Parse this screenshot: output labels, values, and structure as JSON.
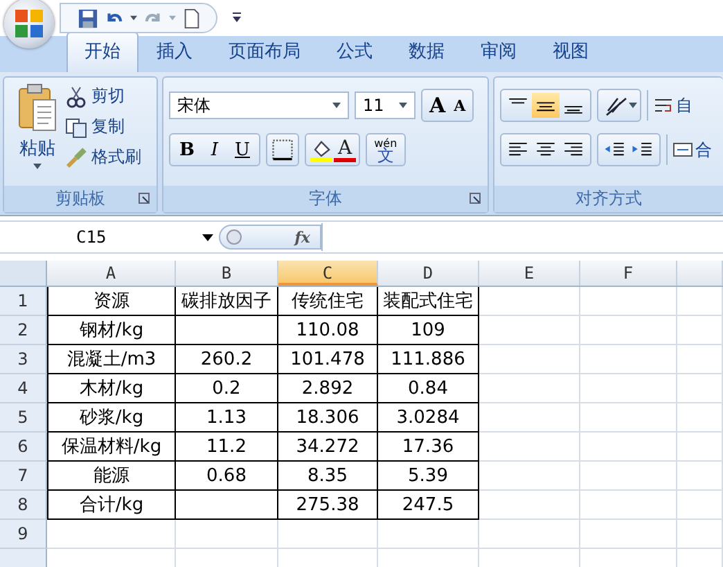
{
  "tabs": [
    {
      "label": "开始",
      "selected": true
    },
    {
      "label": "插入",
      "selected": false
    },
    {
      "label": "页面布局",
      "selected": false
    },
    {
      "label": "公式",
      "selected": false
    },
    {
      "label": "数据",
      "selected": false
    },
    {
      "label": "审阅",
      "selected": false
    },
    {
      "label": "视图",
      "selected": false
    }
  ],
  "clipboard": {
    "title": "剪贴板",
    "paste": "粘贴",
    "items": [
      {
        "label": "剪切",
        "kind": "cut"
      },
      {
        "label": "复制",
        "kind": "copy"
      },
      {
        "label": "格式刷",
        "kind": "brush"
      }
    ]
  },
  "font": {
    "title": "字体",
    "name": "宋体",
    "size": "11",
    "grow": "A",
    "shrink": "A",
    "bold": "B",
    "italic": "I",
    "underline": "U",
    "color_letter": "A",
    "phonetic_top": "wén",
    "phonetic_main": "文"
  },
  "alignment": {
    "title": "对齐方式",
    "vertical": [
      {
        "kind": "top",
        "selected": false
      },
      {
        "kind": "middle",
        "selected": true
      },
      {
        "kind": "bottom",
        "selected": false
      }
    ],
    "wrap": "自",
    "merge": "合"
  },
  "formula_bar": {
    "name_box": "C15",
    "fx": "fx"
  },
  "columns": [
    {
      "label": "A",
      "selected": false
    },
    {
      "label": "B",
      "selected": false
    },
    {
      "label": "C",
      "selected": true
    },
    {
      "label": "D",
      "selected": false
    },
    {
      "label": "E",
      "selected": false
    },
    {
      "label": "F",
      "selected": false
    }
  ],
  "rows": [
    {
      "header": "1",
      "cells": [
        "资源",
        "碳排放因子",
        "传统住宅",
        "装配式住宅"
      ]
    },
    {
      "header": "2",
      "cells": [
        "钢材/kg",
        null,
        "110.08",
        "109"
      ]
    },
    {
      "header": "3",
      "cells": [
        "混凝土/m3",
        "260.2",
        "101.478",
        "111.886"
      ]
    },
    {
      "header": "4",
      "cells": [
        "木材/kg",
        "0.2",
        "2.892",
        "0.84"
      ]
    },
    {
      "header": "5",
      "cells": [
        "砂浆/kg",
        "1.13",
        "18.306",
        "3.0284"
      ]
    },
    {
      "header": "6",
      "cells": [
        "保温材料/kg",
        "11.2",
        "34.272",
        "17.36"
      ]
    },
    {
      "header": "7",
      "cells": [
        "能源",
        "0.68",
        "8.35",
        "5.39"
      ]
    },
    {
      "header": "8",
      "cells": [
        "合计/kg",
        null,
        "275.38",
        "247.5"
      ]
    },
    {
      "header": "9"
    }
  ]
}
